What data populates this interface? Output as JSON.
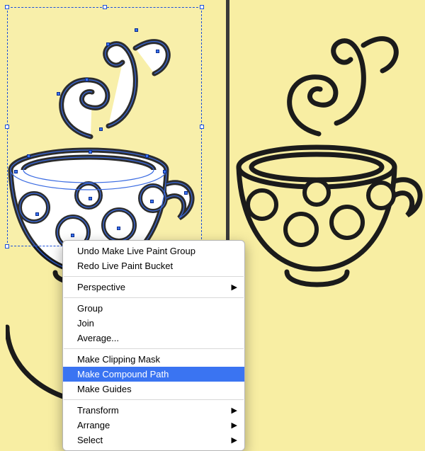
{
  "colors": {
    "canvas_bg": "#f8eea3",
    "selection": "#1a4fd8",
    "anchor": "#3a74f2",
    "menu_highlight": "#3a74f2",
    "divider": "#3a3a3a"
  },
  "icons": {
    "submenu_arrow": "▶"
  },
  "context_menu": {
    "items": [
      {
        "label": "Undo Make Live Paint Group",
        "submenu": false
      },
      {
        "label": "Redo Live Paint Bucket",
        "submenu": false
      },
      {
        "sep": true
      },
      {
        "label": "Perspective",
        "submenu": true
      },
      {
        "sep": true
      },
      {
        "label": "Group",
        "submenu": false
      },
      {
        "label": "Join",
        "submenu": false
      },
      {
        "label": "Average...",
        "submenu": false
      },
      {
        "sep": true
      },
      {
        "label": "Make Clipping Mask",
        "submenu": false
      },
      {
        "label": "Make Compound Path",
        "submenu": false,
        "highlight": true
      },
      {
        "label": "Make Guides",
        "submenu": false
      },
      {
        "sep": true
      },
      {
        "label": "Transform",
        "submenu": true
      },
      {
        "label": "Arrange",
        "submenu": true
      },
      {
        "label": "Select",
        "submenu": true
      }
    ]
  }
}
